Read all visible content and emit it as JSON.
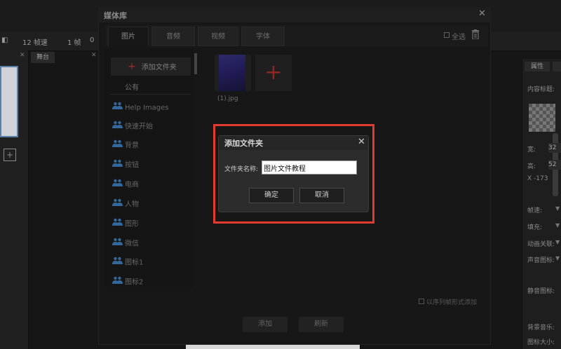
{
  "colors": {
    "accent": "#e23b2e",
    "add_plus": "#b03030"
  },
  "toolbar": {
    "framerate": "12 帧速",
    "frames": "1 帧",
    "zero": "0"
  },
  "stage": {
    "tab_label": "舞台"
  },
  "right_panel": {
    "tab_label": "属性",
    "content_title": "内容标题:",
    "width_label": "宽:",
    "width_value": "32",
    "height_label": "高:",
    "height_value": "52",
    "x_label": "X -173",
    "framerate_label": "帧速:",
    "fill_label": "填充:",
    "anim_label": "动画关联:",
    "sound_icon_label": "声音图标:",
    "mute_icon_label": "静音图标:",
    "bgmusic_label": "背景音乐:",
    "icon_size_label": "图标大小:"
  },
  "media_library": {
    "title": "媒体库",
    "close_glyph": "✕",
    "tabs": [
      "图片",
      "音频",
      "视频",
      "字体"
    ],
    "select_all": "全选",
    "add_folder": "添加文件夹",
    "public_header": "公有",
    "folders": [
      "Help Images",
      "快速开始",
      "背景",
      "按钮",
      "电商",
      "人物",
      "图形",
      "微信",
      "图标1",
      "图标2"
    ],
    "image_caption": "(1).jpg",
    "sequence_option": "以序列帧形式添加",
    "add_button": "添加",
    "refresh_button": "刷新"
  },
  "add_folder_dialog": {
    "title": "添加文件夹",
    "close_glyph": "✕",
    "name_label": "文件夹名称:",
    "name_value": "图片文件教程",
    "confirm": "确定",
    "cancel": "取消"
  }
}
